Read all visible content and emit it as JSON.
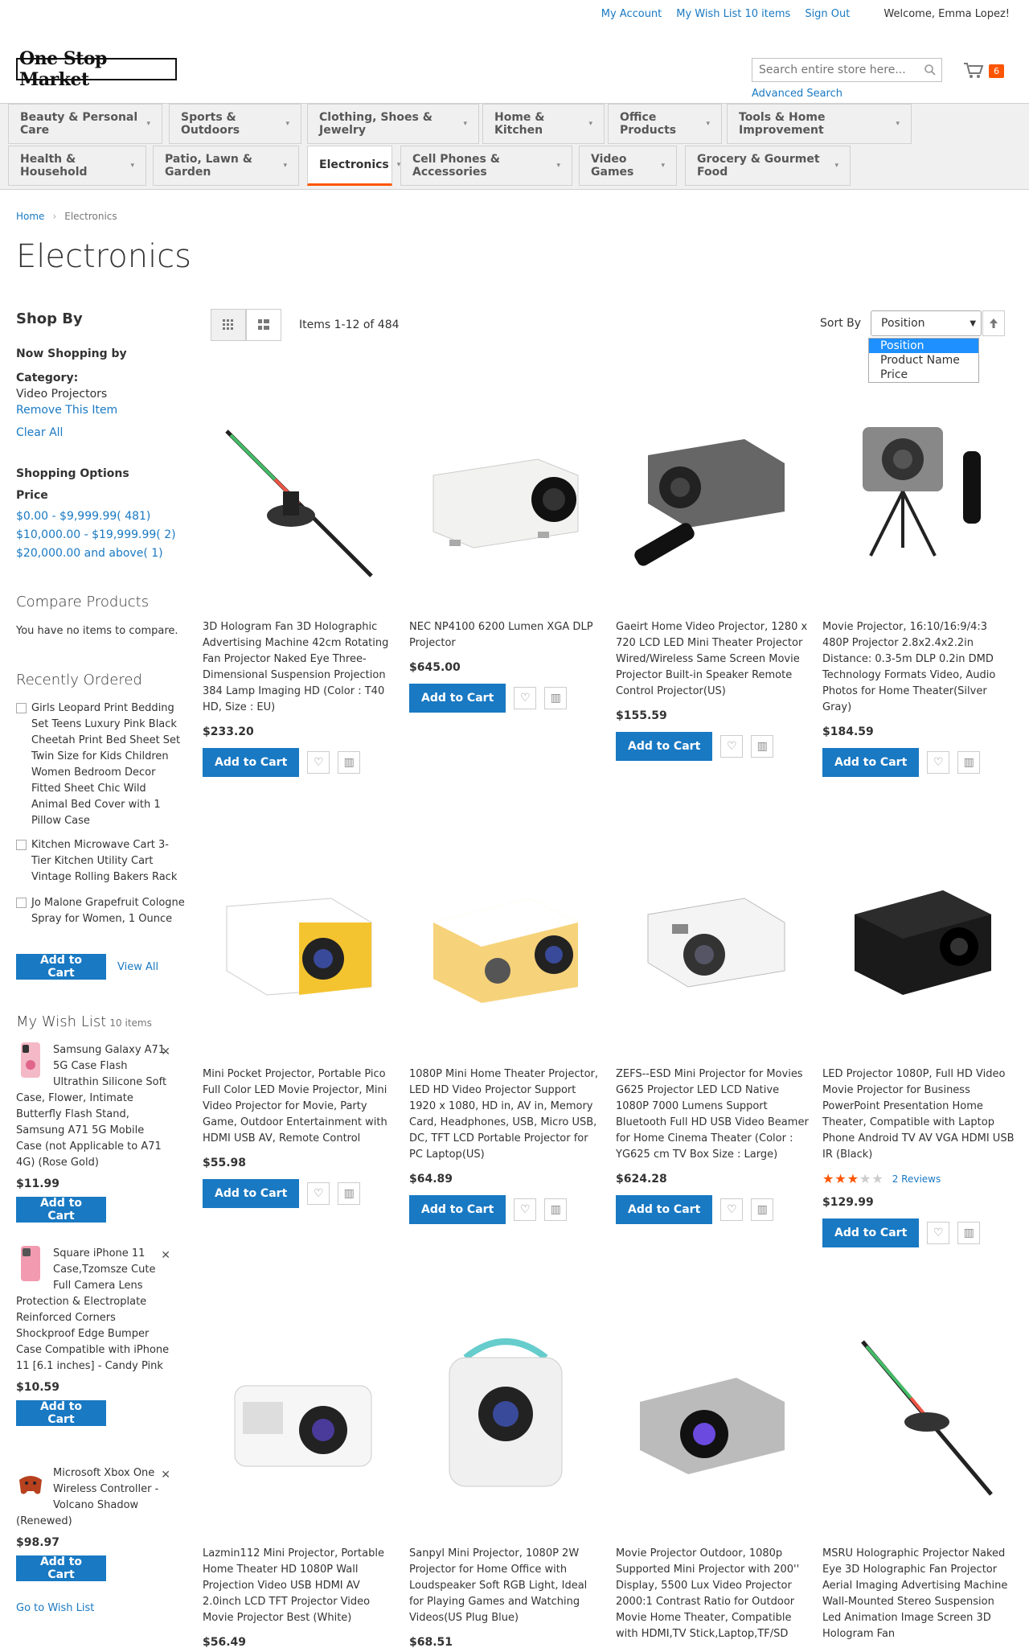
{
  "header": {
    "my_account": "My Account",
    "wishlist_link": "My Wish List 10 items",
    "sign_out": "Sign Out",
    "welcome": "Welcome, Emma Lopez!",
    "logo": "One Stop Market",
    "search_placeholder": "Search entire store here...",
    "advanced_search": "Advanced Search",
    "cart_count": "6"
  },
  "nav": {
    "row1": [
      "Beauty & Personal Care",
      "Sports & Outdoors",
      "Clothing, Shoes & Jewelry",
      "Home & Kitchen",
      "Office Products",
      "Tools & Home Improvement"
    ],
    "row2": [
      "Health & Household",
      "Patio, Lawn & Garden",
      "Electronics",
      "Cell Phones & Accessories",
      "Video Games",
      "Grocery & Gourmet Food"
    ]
  },
  "breadcrumb": {
    "home": "Home",
    "current": "Electronics"
  },
  "page_title": "Electronics",
  "sidebar": {
    "shop_by": "Shop By",
    "now_shopping_by": "Now Shopping by",
    "category_label": "Category:",
    "category_value": "Video Projectors",
    "remove_label": "Remove This Item",
    "clear_all": "Clear All",
    "shopping_options": "Shopping Options",
    "price_label": "Price",
    "price_ranges": [
      {
        "range": "$0.00 - $9,999.99",
        "count": "( 481)"
      },
      {
        "range": "$10,000.00 - $19,999.99",
        "count": "( 2)"
      },
      {
        "range": "$20,000.00 and above",
        "count": "( 1)"
      }
    ],
    "compare_title": "Compare Products",
    "compare_empty": "You have no items to compare.",
    "recently_ordered_title": "Recently Ordered",
    "recently_ordered": [
      "Girls Leopard Print Bedding Set Teens Luxury Pink Black Cheetah Print Bed Sheet Set Twin Size for Kids Children Women Bedroom Decor Fitted Sheet Chic Wild Animal Bed Cover with 1 Pillow Case",
      "Kitchen Microwave Cart 3-Tier Kitchen Utility Cart Vintage Rolling Bakers Rack",
      "Jo Malone Grapefruit Cologne Spray for Women, 1 Ounce"
    ],
    "add_to_cart": "Add to Cart",
    "view_all": "View All",
    "wishlist_title": "My Wish List",
    "wishlist_count": "10 items",
    "wishlist": [
      {
        "name": "Samsung Galaxy A71 5G Case Flash Ultrathin Silicone Soft Case, Flower, Intimate Butterfly Flash Stand, Samsung A71 5G Mobile Case (not Applicable to A71 4G) (Rose Gold)",
        "price": "$11.99"
      },
      {
        "name": "Square iPhone 11 Case,Tzomsze Cute Full Camera Lens Protection & Electroplate Reinforced Corners Shockproof Edge Bumper Case Compatible with iPhone 11 [6.1 inches] - Candy Pink",
        "price": "$10.59"
      },
      {
        "name": "Microsoft Xbox One Wireless Controller - Volcano Shadow (Renewed)",
        "price": "$98.97"
      }
    ],
    "go_to_wishlist": "Go to Wish List"
  },
  "toolbar": {
    "items": "Items 1-12 of 484",
    "sort_by": "Sort By",
    "sort_selected": "Position",
    "sort_options": [
      "Position",
      "Product Name",
      "Price"
    ]
  },
  "products": [
    {
      "name": "3D Hologram Fan 3D Holographic Advertising Machine 42cm Rotating Fan Projector Naked Eye Three-Dimensional Suspension Projection 384 Lamp Imaging HD (Color : T40 HD, Size : EU)",
      "price": "$233.20"
    },
    {
      "name": "NEC NP4100 6200 Lumen XGA DLP Projector",
      "price": "$645.00"
    },
    {
      "name": "Gaeirt Home Video Projector, 1280 x 720 LCD LED Mini Theater Projector Wired/Wireless Same Screen Movie Projector Built-in Speaker Remote Control Projector(US)",
      "price": "$155.59"
    },
    {
      "name": "Movie Projector, 16:10/16:9/4:3 480P Projector 2.8x2.4x2.2in Distance: 0.3-5m DLP 0.2in DMD Technology Formats Video, Audio Photos for Home Theater(Silver Gray)",
      "price": "$184.59"
    },
    {
      "name": "Mini Pocket Projector, Portable Pico Full Color LED Movie Projector, Mini Video Projector for Movie, Party Game, Outdoor Entertainment with HDMI USB AV, Remote Control",
      "price": "$55.98"
    },
    {
      "name": "1080P Mini Home Theater Projector, LED HD Video Projector Support 1920 x 1080, HD in, AV in, Memory Card, Headphones, USB, Micro USB, DC, TFT LCD Portable Projector for PC Laptop(US)",
      "price": "$64.89"
    },
    {
      "name": "ZEFS--ESD Mini Projector for Movies G625 Projector LED LCD Native 1080P 7000 Lumens Support Bluetooth Full HD USB Video Beamer for Home Cinema Theater (Color : YG625 cm TV Box Size : Large)",
      "price": "$624.28"
    },
    {
      "name": "LED Projector 1080P, Full HD Video Movie Projector for Business PowerPoint Presentation Home Theater, Compatible with Laptop Phone Android TV AV VGA HDMI USB IR (Black)",
      "price": "$129.99",
      "rating": 3,
      "reviews": "2 Reviews"
    },
    {
      "name": "Lazmin112 Mini Projector, Portable Home Theater HD 1080P Wall Projection Video USB HDMI AV 2.0inch LCD TFT Projector Video Movie Projector Best (White)",
      "price": "$56.49"
    },
    {
      "name": "Sanpyl Mini Projector, 1080P 2W Projector for Home Office with Loudspeaker Soft RGB Light, Ideal for Playing Games and Watching Videos(US Plug Blue)",
      "price": "$68.51"
    },
    {
      "name": "Movie Projector Outdoor, 1080p Supported Mini Projector with 200'' Display, 5500 Lux Video Projector 2000:1 Contrast Ratio for Outdoor Movie Home Theater, Compatible with HDMI,TV Stick,Laptop,TF/SD",
      "price": ""
    },
    {
      "name": "MSRU Holographic Projector Naked Eye 3D Holographic Fan Projector Aerial Imaging Advertising Machine Wall-Mounted Stereo Suspension Led Animation Image Screen 3D Hologram Fan",
      "price": ""
    }
  ],
  "colors": {
    "primary_button": "#1979c3",
    "accent": "#ff5501",
    "link": "#1979c3"
  }
}
